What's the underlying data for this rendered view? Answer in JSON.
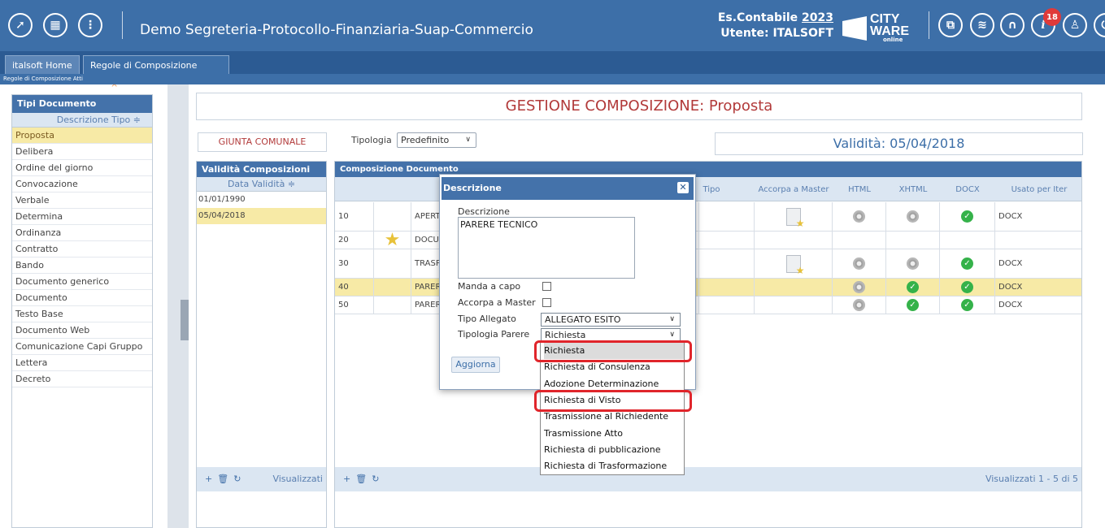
{
  "header": {
    "app_title": "Demo Segreteria-Protocollo-Finanziaria-Suap-Commercio",
    "es_contabile_label": "Es.Contabile",
    "es_contabile_year": "2023",
    "utente": "Utente: ITALSOFT",
    "logo_line1": "CITY",
    "logo_line2": "WARE",
    "logo_sub": "online",
    "notification_count": "18"
  },
  "tabs": [
    {
      "label": "italsoft Home"
    },
    {
      "label": "Regole di Composizione Atti",
      "close": "×"
    }
  ],
  "breadcrumb": "Regole di Composizione Atti",
  "left_panel": {
    "title": "Tipi Documento",
    "column": "Descrizione Tipo ≑",
    "items": [
      "Proposta",
      "Delibera",
      "Ordine del giorno",
      "Convocazione",
      "Verbale",
      "Determina",
      "Ordinanza",
      "Contratto",
      "Bando",
      "Documento generico",
      "Documento",
      "Testo Base",
      "Documento Web",
      "Comunicazione Capi Gruppo",
      "Lettera",
      "Decreto"
    ],
    "selected_index": 0
  },
  "main": {
    "title": "GESTIONE COMPOSIZIONE: Proposta",
    "giunta": "GIUNTA COMUNALE",
    "tipologia_label": "Tipologia",
    "tipologia_value": "Predefinito",
    "validita": "Validità: 05/04/2018"
  },
  "validita_panel": {
    "title": "Validità Composizioni",
    "column": "Data Validità ≑",
    "rows": [
      "01/01/1990",
      "05/04/2018"
    ],
    "footer_text": "Visualizzati"
  },
  "composizione_panel": {
    "title": "Composizione Documento",
    "columns": {
      "tipo": "Tipo",
      "accorpa": "Accorpa a Master",
      "html": "HTML",
      "xhtml": "XHTML",
      "docx": "DOCX",
      "usato": "Usato per Iter"
    },
    "rows": [
      {
        "seq": "10",
        "desc": "APERTU",
        "usato": "DOCX"
      },
      {
        "seq": "20",
        "desc": "DOCUM",
        "usato": ""
      },
      {
        "seq": "30",
        "desc": "TRASPA",
        "usato": "DOCX"
      },
      {
        "seq": "40",
        "desc": "PARERE",
        "usato": "DOCX"
      },
      {
        "seq": "50",
        "desc": "PARERI",
        "usato": "DOCX"
      }
    ],
    "footer_text": "Visualizzati 1 - 5 di 5"
  },
  "modal": {
    "title": "Descrizione",
    "descrizione_label": "Descrizione",
    "descrizione_value": "PARERE TECNICO",
    "manda_a_capo_label": "Manda a capo",
    "accorpa_label": "Accorpa a Master",
    "tipo_allegato_label": "Tipo Allegato",
    "tipo_allegato_value": "ALLEGATO ESITO",
    "tipologia_parere_label": "Tipologia Parere",
    "tipologia_parere_value": "Richiesta",
    "aggiorna_label": "Aggiorna"
  },
  "dropdown": {
    "options": [
      "Richiesta",
      "Richiesta di Consulenza",
      "Adozione Determinazione",
      "Richiesta di Visto",
      "Trasmissione al Richiedente",
      "Trasmissione Atto",
      "Richiesta di pubblicazione",
      "Richiesta di Trasformazione"
    ],
    "selected": "Richiesta",
    "highlighted": [
      "Richiesta",
      "Richiesta di Visto"
    ],
    "highlight_color": "#e0252b"
  },
  "colors": {
    "topbar": "#3d6fa8",
    "panel_header": "#4472aa",
    "selected_row": "#f7eaa6",
    "title_red": "#b23a3a"
  }
}
